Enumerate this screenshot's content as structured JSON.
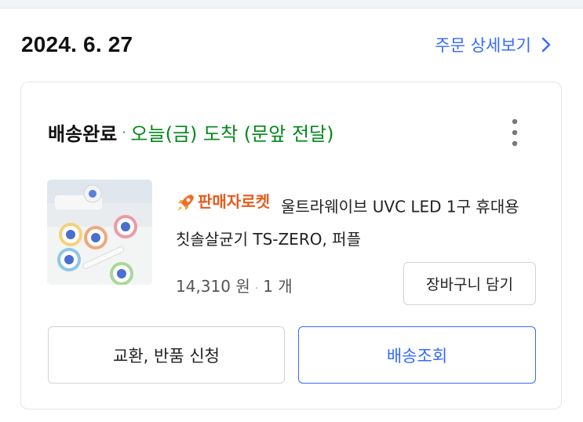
{
  "order": {
    "date": "2024. 6. 27",
    "detail_link": "주문 상세보기"
  },
  "shipment": {
    "status": "배송완료",
    "separator": "·",
    "arrival": "오늘(금) 도착 (문앞 전달)"
  },
  "product": {
    "badge": "판매자로켓",
    "title": "울트라웨이브 UVC LED 1구 휴대용 칫솔살균기 TS-ZERO, 퍼플",
    "price": "14,310 원",
    "quantity": "1 개",
    "price_separator": "·",
    "thumbnail_icon": "toothbrush-sterilizer-photo"
  },
  "buttons": {
    "add_to_cart": "장바구니 담기",
    "exchange_return": "교환, 반품 신청",
    "track_delivery": "배송조회"
  },
  "colors": {
    "link_blue": "#346aff",
    "status_green": "#00891a",
    "rocket_orange": "#e85b1c"
  }
}
